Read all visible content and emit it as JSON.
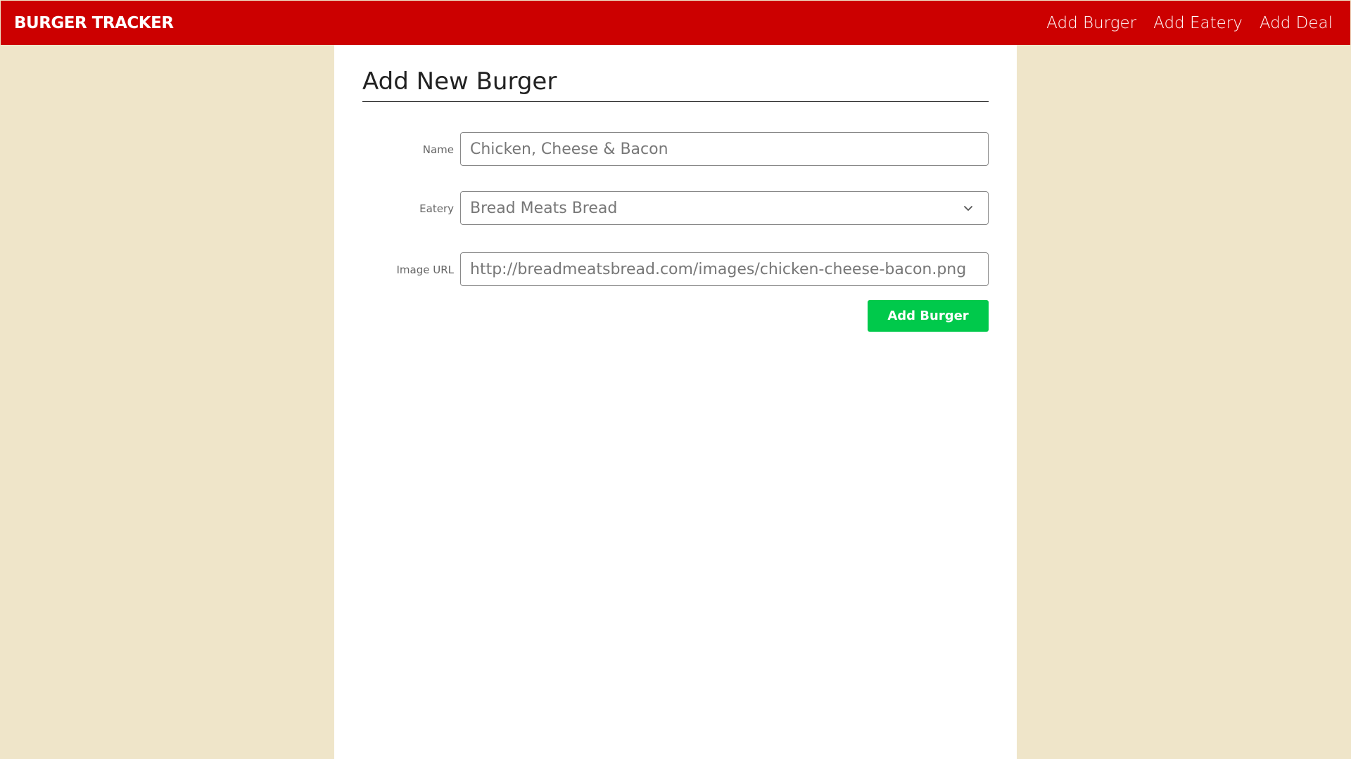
{
  "navbar": {
    "brand": "BURGER TRACKER",
    "links": [
      {
        "label": "Add Burger"
      },
      {
        "label": "Add Eatery"
      },
      {
        "label": "Add Deal"
      }
    ]
  },
  "form": {
    "title": "Add New Burger",
    "name": {
      "label": "Name",
      "value": "Chicken, Cheese & Bacon"
    },
    "eatery": {
      "label": "Eatery",
      "selected": "Bread Meats Bread",
      "icon": "chevron-down-icon"
    },
    "image_url": {
      "label": "Image URL",
      "value": "http://breadmeatsbread.com/images/chicken-cheese-bacon.png"
    },
    "submit_label": "Add Burger"
  },
  "colors": {
    "navbar": "#cc0000",
    "background": "#efe5c9",
    "panel": "#ffffff",
    "submit_button": "#00c94b"
  }
}
